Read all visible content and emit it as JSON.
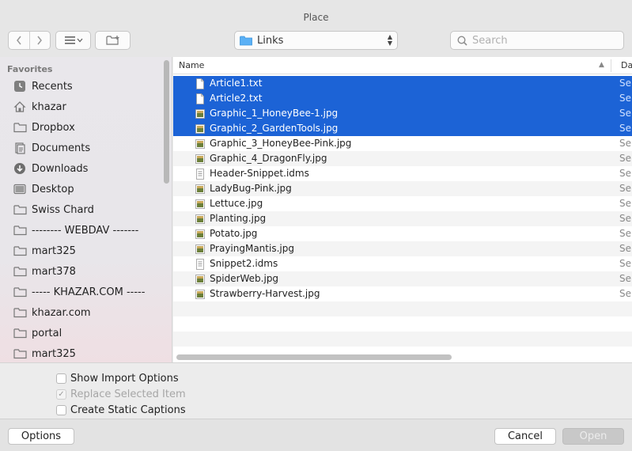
{
  "window": {
    "title": "Place"
  },
  "toolbar": {
    "location_label": "Links",
    "search_placeholder": "Search"
  },
  "sidebar": {
    "heading": "Favorites",
    "items": [
      {
        "label": "Recents",
        "icon": "clock-icon"
      },
      {
        "label": "khazar",
        "icon": "home-icon"
      },
      {
        "label": "Dropbox",
        "icon": "folder-icon"
      },
      {
        "label": "Documents",
        "icon": "document-icon"
      },
      {
        "label": "Downloads",
        "icon": "download-icon"
      },
      {
        "label": "Desktop",
        "icon": "desktop-icon"
      },
      {
        "label": "Swiss Chard",
        "icon": "folder-icon"
      },
      {
        "label": "-------- WEBDAV -------",
        "icon": "folder-icon"
      },
      {
        "label": "mart325",
        "icon": "folder-icon"
      },
      {
        "label": "mart378",
        "icon": "folder-icon"
      },
      {
        "label": "----- KHAZAR.COM -----",
        "icon": "folder-icon"
      },
      {
        "label": "khazar.com",
        "icon": "folder-icon"
      },
      {
        "label": "portal",
        "icon": "folder-icon"
      },
      {
        "label": "mart325",
        "icon": "folder-icon"
      }
    ]
  },
  "filelist": {
    "columns": {
      "name": "Name",
      "date": "Da"
    },
    "date_prefix": "Sep",
    "selection_color": "#1c63d6",
    "files": [
      {
        "name": "Article1.txt",
        "type": "text",
        "selected": true
      },
      {
        "name": "Article2.txt",
        "type": "text",
        "selected": true
      },
      {
        "name": "Graphic_1_HoneyBee-1.jpg",
        "type": "image",
        "selected": true
      },
      {
        "name": "Graphic_2_GardenTools.jpg",
        "type": "image",
        "selected": true
      },
      {
        "name": "Graphic_3_HoneyBee-Pink.jpg",
        "type": "image",
        "selected": false
      },
      {
        "name": "Graphic_4_DragonFly.jpg",
        "type": "image",
        "selected": false
      },
      {
        "name": "Header-Snippet.idms",
        "type": "snippet",
        "selected": false
      },
      {
        "name": "LadyBug-Pink.jpg",
        "type": "image",
        "selected": false
      },
      {
        "name": "Lettuce.jpg",
        "type": "image",
        "selected": false
      },
      {
        "name": "Planting.jpg",
        "type": "image",
        "selected": false
      },
      {
        "name": "Potato.jpg",
        "type": "image",
        "selected": false
      },
      {
        "name": "PrayingMantis.jpg",
        "type": "image",
        "selected": false
      },
      {
        "name": "Snippet2.idms",
        "type": "snippet",
        "selected": false
      },
      {
        "name": "SpiderWeb.jpg",
        "type": "image",
        "selected": false
      },
      {
        "name": "Strawberry-Harvest.jpg",
        "type": "image",
        "selected": false
      }
    ]
  },
  "options": {
    "show_import_options": {
      "label": "Show Import Options",
      "checked": false,
      "enabled": true
    },
    "replace_selected_item": {
      "label": "Replace Selected Item",
      "checked": true,
      "enabled": false
    },
    "create_static_captions": {
      "label": "Create Static Captions",
      "checked": false,
      "enabled": true
    }
  },
  "buttons": {
    "options": "Options",
    "cancel": "Cancel",
    "open": "Open"
  }
}
